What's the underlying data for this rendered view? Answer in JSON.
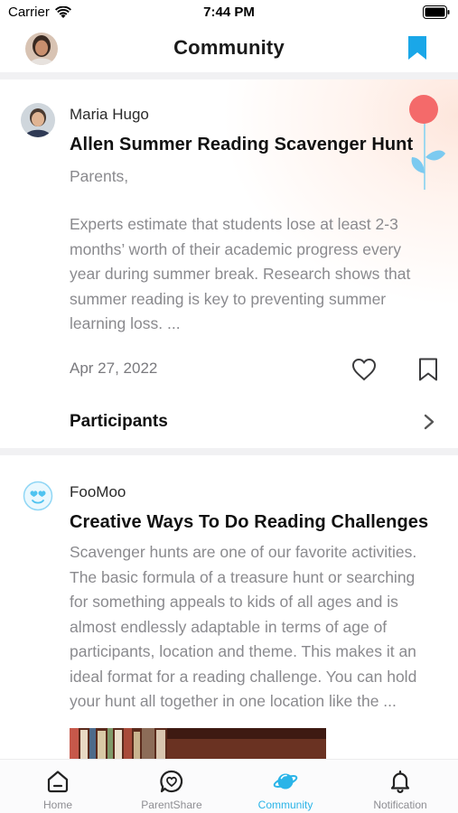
{
  "status_bar": {
    "carrier": "Carrier",
    "time": "7:44 PM"
  },
  "header": {
    "title": "Community"
  },
  "posts": [
    {
      "author": "Maria Hugo",
      "title": "Allen Summer Reading Scavenger Hunt",
      "greeting": "Parents,",
      "body": "Experts estimate that students lose at least 2-3 months’ worth of their academic progress every year during summer break. Research shows that summer reading is key to preventing summer learning loss.  ...",
      "date": "Apr 27, 2022",
      "participants_label": "Participants"
    },
    {
      "author": "FooMoo",
      "title": "Creative Ways To Do Reading Challenges",
      "body": "Scavenger hunts are one of our favorite activities. The basic formula of a treasure hunt or searching for something appeals to kids of all ages and is almost endlessly adaptable in terms of age of participants, location and theme. This makes it an ideal format for a reading challenge. You can hold your hunt all together in one location like the ..."
    }
  ],
  "tabs": [
    {
      "label": "Home",
      "icon": "home-icon",
      "active": false
    },
    {
      "label": "ParentShare",
      "icon": "heart-chat-icon",
      "active": false
    },
    {
      "label": "Community",
      "icon": "planet-icon",
      "active": true
    },
    {
      "label": "Notification",
      "icon": "bell-icon",
      "active": false
    }
  ],
  "colors": {
    "accent": "#2ab4e8",
    "flower_red": "#f46a6a",
    "text_muted": "#8a8a8e"
  }
}
